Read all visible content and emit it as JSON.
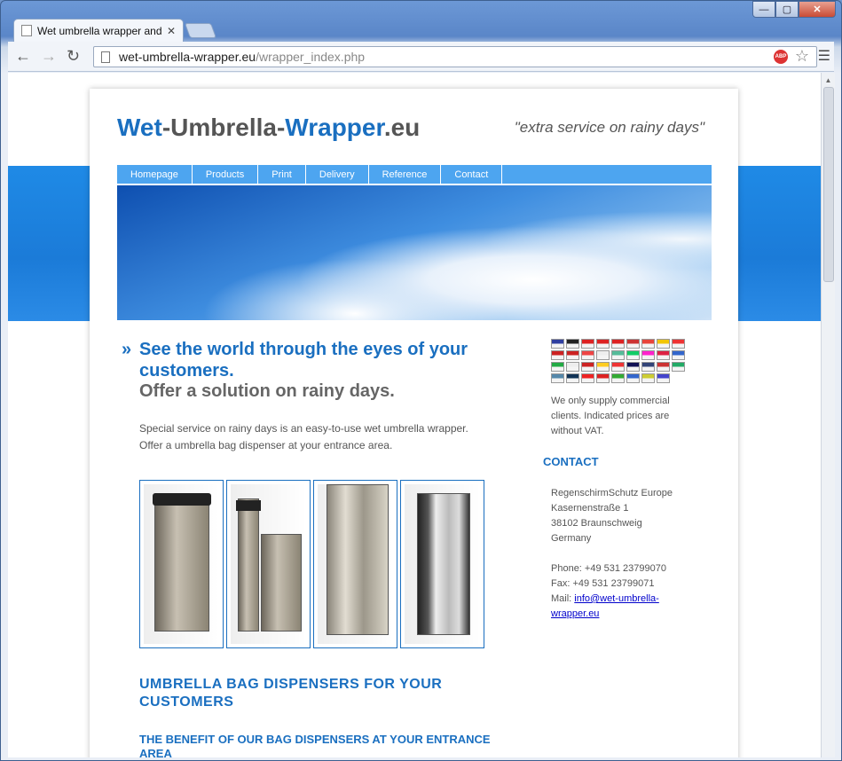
{
  "browser": {
    "tab_title": "Wet umbrella wrapper and",
    "url_host": "wet-umbrella-wrapper.eu",
    "url_path": "/wrapper_index.php",
    "adblock_label": "ABP"
  },
  "site": {
    "logo_part1": "Wet",
    "logo_part2": "-Umbrella-",
    "logo_part3": "Wrapper",
    "logo_part4": ".eu",
    "slogan": "\"extra service on rainy days\"",
    "nav": [
      "Homepage",
      "Products",
      "Print",
      "Delivery",
      "Reference",
      "Contact"
    ]
  },
  "main": {
    "headline_marker": "»",
    "headline": "See the world through the eyes of your customers.",
    "subline": "Offer a solution on rainy days.",
    "intro_1": "Special service on rainy days is an easy-to-use wet umbrella wrapper.",
    "intro_2": "Offer a umbrella bag dispenser at your entrance area.",
    "section_title": "UMBRELLA BAG DISPENSERS FOR YOUR CUSTOMERS",
    "benefit_title": "THE BENEFIT OF OUR BAG DISPENSERS AT YOUR ENTRANCE AREA"
  },
  "sidebar": {
    "flag_colors": [
      "#2f3fa0",
      "#222",
      "#d22",
      "#d22",
      "#d22",
      "#c33",
      "#e8443a",
      "#f2c500",
      "#e33",
      "#c22",
      "#c22",
      "#e44",
      "#eee",
      "#5b9",
      "#1c6",
      "#f2c",
      "#d24",
      "#36c",
      "#2a4",
      "#eee",
      "#c22",
      "#fc2",
      "#e33",
      "#115",
      "#347",
      "#c33",
      "#2a6",
      "#58a",
      "#135",
      "#e22",
      "#d22",
      "#3a3",
      "#36c",
      "#cc3",
      "#44c"
    ],
    "note": "We only supply commercial clients. Indicated prices are without VAT.",
    "contact_title": "CONTACT",
    "company": "RegenschirmSchutz Europe",
    "street": "Kasernenstraße 1",
    "city": "38102 Braunschweig",
    "country": "Germany",
    "phone": "Phone: +49 531 23799070",
    "fax": "Fax: +49 531 23799071",
    "mail_label": "Mail: ",
    "mail": "info@wet-umbrella-wrapper.eu"
  }
}
